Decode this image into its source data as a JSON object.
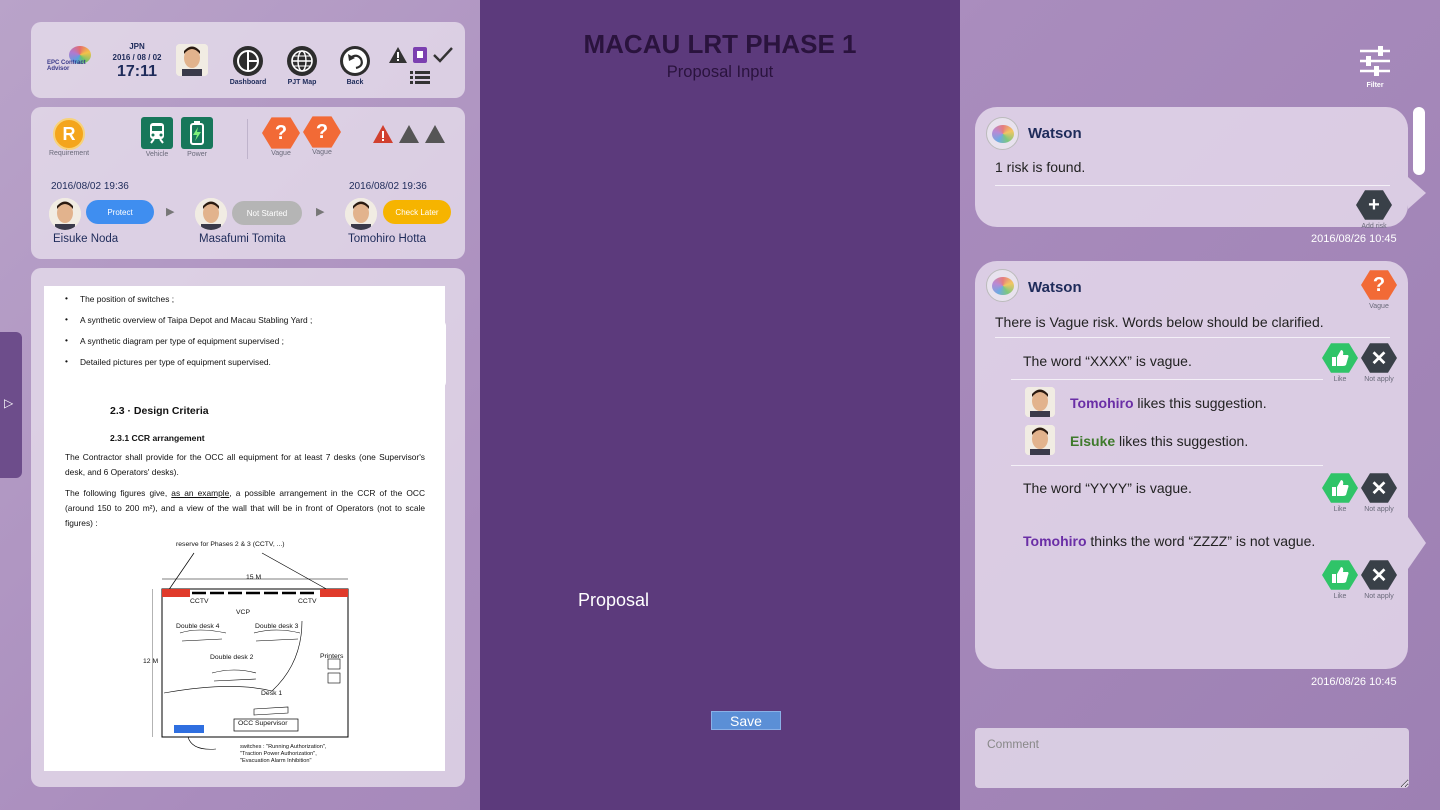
{
  "header": {
    "logo_text": "EPC Contract Advisor",
    "country": "JPN",
    "date": "2016 / 08 / 02",
    "time": "17:11",
    "buttons": [
      {
        "label": "Dashboard",
        "icon": "dashboard-icon"
      },
      {
        "label": "PJT Map",
        "icon": "globe-icon"
      },
      {
        "label": "Back",
        "icon": "back-icon"
      }
    ]
  },
  "status": {
    "requirement_label": "Requirement",
    "requirement_badge": "R",
    "vehicle_label": "Vehicle",
    "power_label": "Power",
    "vague1_label": "Vague",
    "vague2_label": "Vague",
    "vague_badge": "?",
    "workflow": [
      {
        "timestamp": "2016/08/02 19:36",
        "name": "Eisuke Noda",
        "status": "Protect",
        "status_color": "#3f8ef0"
      },
      {
        "timestamp": "",
        "name": "Masafumi Tomita",
        "status": "Not Started",
        "status_color": "#b5b5b5"
      },
      {
        "timestamp": "2016/08/02 19:36",
        "name": "Tomohiro Hotta",
        "status": "Check Later",
        "status_color": "#f6b400"
      }
    ]
  },
  "document": {
    "bullets": [
      "The position of switches ;",
      "A synthetic overview of Taipa Depot and Macau Stabling Yard ;",
      "A synthetic diagram per type of equipment supervised ;",
      "Detailed pictures per type of equipment supervised."
    ],
    "section_title": "2.3 · Design Criteria",
    "subsection_title": "2.3.1 CCR arrangement",
    "paragraph1": "The Contractor shall provide for the OCC all equipment for at least 7 desks (one Supervisor's desk, and 6 Operators' desks).",
    "paragraph2_a": "The following figures give, ",
    "paragraph2_u": "as an example",
    "paragraph2_b": ", a possible arrangement in the CCR of the OCC (around 150 to 200 m²), and a view of the wall that will be in front of Operators (not to scale figures) :",
    "figure": {
      "reserve": "reserve for Phases 2 & 3 (CCTV, ...)",
      "width": "15 M",
      "height": "12 M",
      "cctv_left": "CCTV",
      "cctv_right": "CCTV",
      "vcp": "VCP",
      "desk4": "Double desk 4",
      "desk3": "Double desk 3",
      "desk2": "Double desk 2",
      "printers": "Printers",
      "desk1": "Desk 1",
      "supervisor": "OCC Supervisor",
      "switches1": "switches : \"Running Authorization\",",
      "switches2": "\"Traction Power Authorization\",",
      "switches3": "\"Evacuation Alarm Inhibition\""
    }
  },
  "center": {
    "title": "MACAU LRT PHASE 1",
    "subtitle": "Proposal Input",
    "proposal_label": "Proposal",
    "save_label": "Save"
  },
  "right": {
    "filter_label": "Filter",
    "message1": {
      "sender": "Watson",
      "text": "1 risk is found.",
      "add_risk_label": "Add risk",
      "time": "2016/08/26 10:45"
    },
    "message2": {
      "sender": "Watson",
      "vague_label": "Vague",
      "intro": "There is Vague risk. Words below should be clarified.",
      "word1": "The word “XXXX” is vague.",
      "like1_user": "Tomohiro",
      "like1_text": " likes this suggestion.",
      "like2_user": "Eisuke",
      "like2_text": " likes this suggestion.",
      "word2": "The word “YYYY” is vague.",
      "comment_user": "Tomohiro",
      "comment_text": " thinks the word “ZZZZ” is not vague.",
      "like_label": "Like",
      "not_apply_label": "Not apply",
      "time": "2016/08/26 10:45"
    },
    "comment_placeholder": "Comment"
  }
}
